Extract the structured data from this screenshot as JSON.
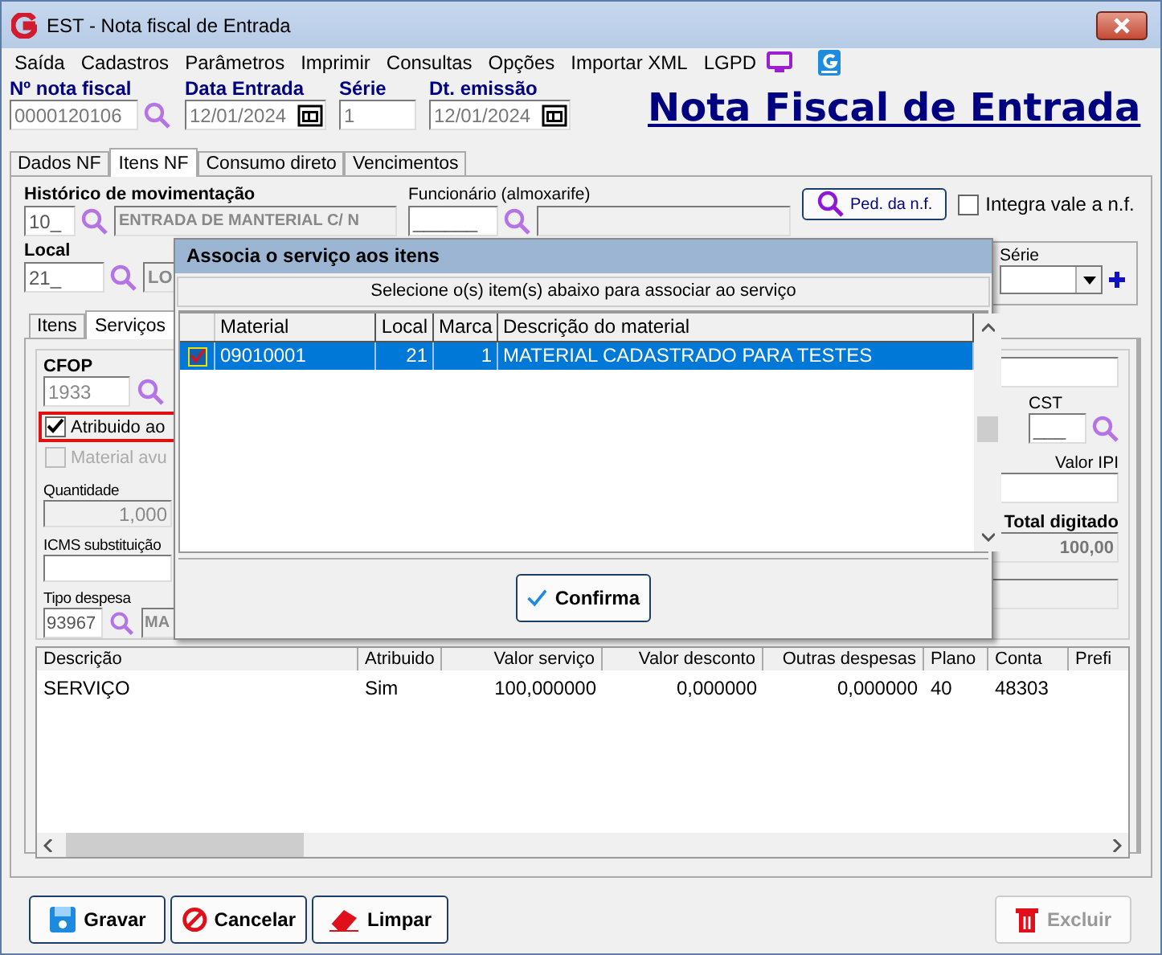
{
  "window": {
    "title": "EST - Nota fiscal de Entrada"
  },
  "menu": [
    {
      "label": "Saída"
    },
    {
      "label": "Cadastros"
    },
    {
      "label": "Parâmetros"
    },
    {
      "label": "Imprimir"
    },
    {
      "label": "Consultas"
    },
    {
      "label": "Opções"
    },
    {
      "label": "Importar XML"
    },
    {
      "label": "LGPD"
    }
  ],
  "header": {
    "fields": [
      {
        "label": "Nº nota fiscal",
        "value": "0000120106",
        "kind": "search"
      },
      {
        "label": "Data Entrada",
        "value": "12/01/2024",
        "kind": "date"
      },
      {
        "label": "Série",
        "value": "1",
        "kind": "plain"
      },
      {
        "label": "Dt. emissão",
        "value": "12/01/2024",
        "kind": "date"
      }
    ],
    "heading": "Nota Fiscal de Entrada"
  },
  "tabs": [
    {
      "label": "Dados NF",
      "selected": false
    },
    {
      "label": "Itens NF",
      "selected": true
    },
    {
      "label": "Consumo direto",
      "selected": false
    },
    {
      "label": "Vencimentos",
      "selected": false
    }
  ],
  "movement": {
    "historico_label": "Histórico de movimentação",
    "historico_code": "10_",
    "historico_desc": "ENTRADA DE MANTERIAL C/ N",
    "funcionario_label": "Funcionário (almoxarife)",
    "funcionario_code": "______",
    "order_button": "Ped. da n.f.",
    "integra": {
      "label": "Integra vale a n.f.",
      "checked": false
    },
    "local_label": "Local",
    "local_code": "21_",
    "local_desc": "LO",
    "serie_label": "Série"
  },
  "subtabs": [
    {
      "label": "Itens",
      "selected": false
    },
    {
      "label": "Serviços",
      "selected": true
    }
  ],
  "service_form": {
    "cfop_label": "CFOP",
    "cfop": "1933",
    "options": [
      {
        "label": "Atribuido ao",
        "checked": true,
        "disabled": false,
        "highlighted": true
      },
      {
        "label": "Material avu",
        "checked": false,
        "disabled": true,
        "highlighted": false
      }
    ],
    "quantidade_label": "Quantidade",
    "quantidade": "1,000",
    "icms_label": "ICMS substituição",
    "tipo_label": "Tipo despesa",
    "tipo_code": "93967",
    "tipo_desc": "MA",
    "cst_label": "CST",
    "cst": "___",
    "ipi_label": "Valor IPI",
    "total_label": "Total digitado",
    "total": "100,00"
  },
  "services_table": {
    "columns": [
      {
        "label": "Descrição",
        "kind": "text"
      },
      {
        "label": "Atribuido",
        "kind": "text"
      },
      {
        "label": "Valor serviço",
        "kind": "number"
      },
      {
        "label": "Valor desconto",
        "kind": "number"
      },
      {
        "label": "Outras despesas",
        "kind": "number"
      },
      {
        "label": "Plano",
        "kind": "text"
      },
      {
        "label": "Conta",
        "kind": "text"
      },
      {
        "label": "Prefi",
        "kind": "text"
      }
    ],
    "rows": [
      {
        "cells": [
          "SERVIÇO",
          "Sim",
          "100,000000",
          "0,000000",
          "0,000000",
          "40",
          "48303"
        ]
      }
    ]
  },
  "buttons": [
    {
      "label": "Gravar",
      "kind": "save",
      "disabled": false
    },
    {
      "label": "Cancelar",
      "kind": "cancel",
      "disabled": false
    },
    {
      "label": "Limpar",
      "kind": "clear",
      "disabled": false
    },
    {
      "label": "Excluir",
      "kind": "delete",
      "disabled": true
    }
  ],
  "dialog": {
    "title": "Associa o serviço aos itens",
    "instruction": "Selecione o(s) item(s) abaixo para associar ao serviço",
    "columns": [
      {
        "label": "Material",
        "kind": "text"
      },
      {
        "label": "Local",
        "kind": "number"
      },
      {
        "label": "Marca",
        "kind": "number"
      },
      {
        "label": "Descrição do material",
        "kind": "text"
      }
    ],
    "rows": [
      {
        "checked": true,
        "selected": true,
        "cells": [
          "09010001",
          "21",
          "1",
          "MATERIAL CADASTRADO PARA TESTES"
        ]
      }
    ],
    "confirm": "Confirma"
  }
}
